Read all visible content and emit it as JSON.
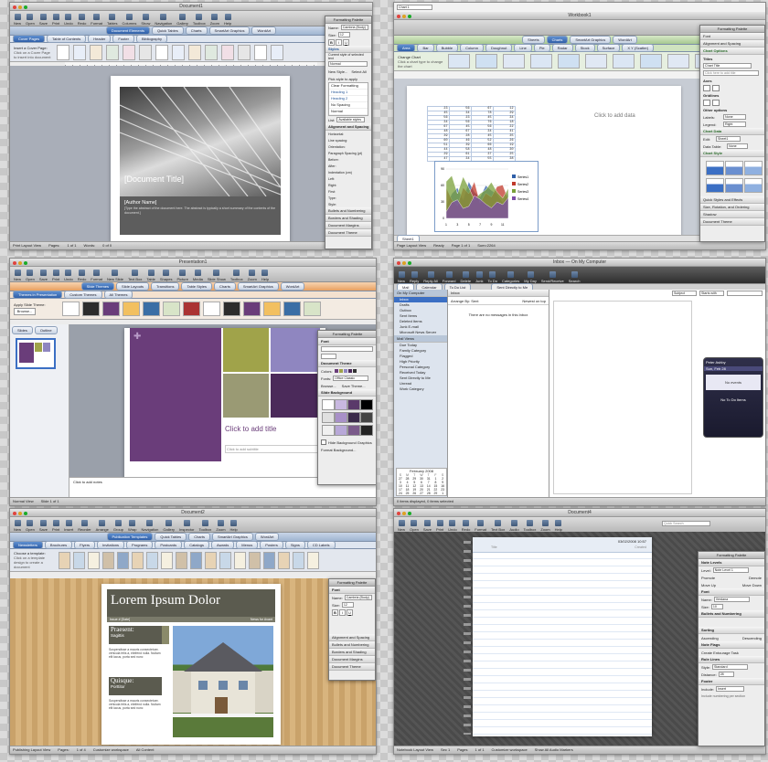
{
  "colors": {
    "accent": "#3b6fc4",
    "chart_green": "#5aa64a",
    "ppt_orange": "#f0a050",
    "purple": "#6a3d7a",
    "olive": "#a0a34a"
  },
  "word": {
    "title": "Document1",
    "toolbar": [
      "New",
      "Open",
      "Save",
      "Print",
      "Undo",
      "Redo",
      "Format",
      "Tables",
      "Columns",
      "Show",
      "Navigation",
      "Gallery",
      "Toolbox",
      "Zoom",
      "Help"
    ],
    "zoom": "100%",
    "tabs": [
      "Document Elements",
      "Quick Tables",
      "Charts",
      "SmartArt Graphics",
      "WordArt"
    ],
    "subtabs": [
      "Cover Pages",
      "Table of Contents",
      "Header",
      "Footer",
      "Bibliography"
    ],
    "insert_label": "Insert a Cover Page:",
    "hint": "Click on a Cover Page to insert into document",
    "doc_title": "[Document Title]",
    "author": "[Author Name]",
    "abstract": "[Type the abstract of the document here. The abstract is typically a short summary of the contents of the document.]",
    "status": [
      "Print Layout View",
      "Pages:",
      "1 of 1",
      "Words:",
      "0 of 0"
    ],
    "palette": {
      "title": "Formatting Palette",
      "font_label": "Name:",
      "font": "Cambria (Body)",
      "size_label": "Size:",
      "size": "12",
      "styles_title": "Styles",
      "current_style_label": "Current style of selected text",
      "current_style": "Normal",
      "new_style": "New Style...",
      "select_all": "Select All",
      "pick_label": "Pick style to apply",
      "styles": [
        "Clear Formatting",
        "Heading 1",
        "Heading 2",
        "No Spacing",
        "Normal"
      ],
      "list_label": "List:",
      "list_value": "Available styles",
      "sections": [
        "Alignment and Spacing",
        "Bullets and Numbering",
        "Borders and Shading",
        "Document Margins",
        "Document Theme"
      ],
      "fields": [
        "Horizontal:",
        "Line spacing:",
        "Orientation:",
        "Paragraph Spacing (pt)",
        "Before:",
        "After:",
        "Indentation (cm)",
        "Left:",
        "Right:",
        "First:",
        "Type:",
        "Style:"
      ],
      "values": [
        "0",
        "0",
        "0",
        "0",
        "0"
      ]
    }
  },
  "excel": {
    "title": "Workbook1",
    "namebox": "Chart 1",
    "ribbon_tabs": [
      "Sheets",
      "Charts",
      "SmartArt Graphics",
      "WordArt"
    ],
    "chart_types": [
      "Area",
      "Bar",
      "Bubble",
      "Column",
      "Doughnut",
      "Line",
      "Pie",
      "Radar",
      "Stock",
      "Surface",
      "X Y (Scatter)"
    ],
    "change_chart": "Change Chart",
    "hint": "Click a chart type to change the chart",
    "click_to_add": "Click to add data",
    "sheet_tabs": [
      "Sheet1"
    ],
    "status": [
      "Page Layout View",
      "Ready",
      "Page 1 of 1",
      "Sum=2264"
    ],
    "legend": [
      "Series1",
      "Series2",
      "Series3",
      "Series4"
    ],
    "palette": {
      "title": "Formatting Palette",
      "sections": [
        "Font",
        "Alignment and Spacing",
        "Chart Options",
        "Chart Data",
        "Chart Style",
        "Quick Styles and Effects",
        "Size, Rotation, and Ordering",
        "Shadow",
        "Document Theme"
      ],
      "titles_label": "Titles",
      "titles_value": "Chart Title",
      "titles_placeholder": "Click here to add title",
      "axes_label": "Axes",
      "gridlines_label": "Gridlines",
      "other_label": "Other options",
      "labels_label": "Labels:",
      "labels_value": "None",
      "legend_label": "Legend:",
      "legend_value": "Right",
      "data_table_label": "Data Table:",
      "data_table_value": "None",
      "edit_label": "Edit:",
      "edit_value": "Sheet1"
    }
  },
  "chart_data": {
    "type": "area",
    "title": "",
    "xlabel": "",
    "ylabel": "",
    "categories": [
      "1",
      "2",
      "3",
      "4",
      "5",
      "6",
      "7",
      "8",
      "9",
      "10",
      "11",
      "12"
    ],
    "series": [
      {
        "name": "Series1",
        "values": [
          23,
          45,
          56,
          34,
          67,
          48,
          39,
          60,
          51,
          44,
          29,
          47
        ]
      },
      {
        "name": "Series2",
        "values": [
          56,
          34,
          23,
          56,
          45,
          67,
          28,
          46,
          39,
          58,
          61,
          34
        ]
      },
      {
        "name": "Series3",
        "values": [
          67,
          78,
          45,
          76,
          56,
          34,
          45,
          52,
          66,
          48,
          37,
          55
        ]
      },
      {
        "name": "Series4",
        "values": [
          12,
          29,
          34,
          18,
          22,
          41,
          35,
          26,
          19,
          30,
          25,
          38
        ]
      }
    ],
    "ylim": [
      0,
      90
    ]
  },
  "powerpoint": {
    "title": "Presentation1",
    "toolbar": [
      "New",
      "Open",
      "Save",
      "Print",
      "Undo",
      "Redo",
      "Format",
      "New Slide",
      "Text Box",
      "Table",
      "Shapes",
      "Picture",
      "Media",
      "Slide Show",
      "Toolbox",
      "Zoom",
      "Help"
    ],
    "zoom": "66%",
    "tabs": [
      "Slide Themes",
      "Slide Layouts",
      "Transitions",
      "Table Styles",
      "Charts",
      "SmartArt Graphics",
      "WordArt"
    ],
    "subtabs": [
      "Themes in Presentation",
      "Custom Themes",
      "All Themes"
    ],
    "apply_label": "Apply Slide Theme:",
    "browse": "Browse...",
    "view_tabs": [
      "Slides",
      "Outline"
    ],
    "slide_title": "Click to add title",
    "slide_subtitle": "Click to add subtitle",
    "notes": "Click to add notes",
    "status": [
      "Normal View",
      "Slide 1 of 1"
    ],
    "palette": {
      "title": "Formatting Palette",
      "sections": [
        "Font",
        "Document Theme",
        "Slide Background"
      ],
      "colors_label": "Colors:",
      "fonts_label": "Fonts:",
      "fonts_value": "Office Classic",
      "browse": "Browse...",
      "save_theme": "Save Theme...",
      "hide_bg": "Hide Background Graphics",
      "format_bg": "Format Background..."
    }
  },
  "outlook": {
    "title": "Inbox — On My Computer",
    "toolbar": [
      "New",
      "Reply",
      "Reply All",
      "Forward",
      "Delete",
      "Junk",
      "To Do",
      "Categories",
      "My Day",
      "Send/Receive",
      "Search"
    ],
    "nav_tabs": [
      "Mail",
      "Calendar",
      "To Do List"
    ],
    "folders_header": "On My Computer",
    "folders": [
      "Inbox",
      "Drafts",
      "Outbox",
      "Sent Items",
      "Deleted Items",
      "Junk E-mail",
      "Microsoft News Server"
    ],
    "smart_header": "Mail Views",
    "smart": [
      "Due Today",
      "Family Category",
      "Flagged",
      "High Priority",
      "Personal Category",
      "Received Today",
      "Sent Directly to Me",
      "Unread",
      "Work Category"
    ],
    "list_title": "Inbox",
    "arrange_label": "Arrange By: Sent",
    "sort_label": "Newest on top",
    "empty_msg": "There are no messages in this Inbox",
    "subject_label": "Subject",
    "starts_with": "Starts with",
    "filter_label": "Sent Directly to Me",
    "calendar_month": "February 2008",
    "days": [
      "S",
      "M",
      "T",
      "W",
      "T",
      "F",
      "S"
    ],
    "dates": [
      "27",
      "28",
      "29",
      "30",
      "31",
      "1",
      "2",
      "3",
      "4",
      "5",
      "6",
      "7",
      "8",
      "9",
      "10",
      "11",
      "12",
      "13",
      "14",
      "15",
      "16",
      "17",
      "18",
      "19",
      "20",
      "21",
      "22",
      "23",
      "24",
      "25",
      "26",
      "27",
      "28",
      "29",
      "1"
    ],
    "status": "0 items displayed, 0 items selected",
    "myday": {
      "title": "Peter Ashby",
      "date_label": "Sun, Feb 28",
      "events": "No events",
      "todo": "No To Do Items"
    }
  },
  "publish": {
    "title": "Document2",
    "toolbar": [
      "New",
      "Open",
      "Save",
      "Print",
      "Insert",
      "Reorder",
      "Arrange",
      "Group",
      "Wrap",
      "Navigation",
      "Gallery",
      "Inspector",
      "Toolbox",
      "Zoom",
      "Help"
    ],
    "tabs": [
      "Publication Templates",
      "Quick Tables",
      "Charts",
      "SmartArt Graphics",
      "WordArt"
    ],
    "categories": [
      "Newsletters",
      "Brochures",
      "Flyers",
      "Invitations",
      "Programs",
      "Postcards",
      "Catalogs",
      "Awards",
      "Menus",
      "Posters",
      "Signs",
      "CD Labels"
    ],
    "choose_label": "Choose a template:",
    "hint": "Click on a template design to create a document",
    "headline": "Lorem Ipsum Dolor",
    "issue": "Issue # [Date]",
    "news_label": "News for Avant",
    "heading1": "Praesent:",
    "sub1": "Sagittis",
    "heading2": "Quisque:",
    "sub2": "Porttitor",
    "body": "Suspendisse a mauris consectetuer, vehicula felis a, eleifend nulla. Nullam elit lacus, porta sed nunc",
    "status": [
      "Publishing Layout View",
      "Pages:",
      "1 of 4"
    ],
    "workspace": "Customize workspace",
    "master": "All Content",
    "palette": {
      "title": "Formatting Palette",
      "sections": [
        "Font",
        "Alignment and Spacing",
        "Bullets and Numbering",
        "Borders and Shading",
        "Document Margins",
        "Document Theme"
      ],
      "font_label": "Name:",
      "font": "Cambria (Body)",
      "size_label": "Size:",
      "size": "12"
    }
  },
  "notebook": {
    "title": "Document4",
    "toolbar": [
      "New",
      "Open",
      "Save",
      "Print",
      "Undo",
      "Redo",
      "Format",
      "Text Box",
      "Audio",
      "Toolbox",
      "Zoom",
      "Help"
    ],
    "zoom": "100%",
    "search_placeholder": "Quick Search",
    "page_date": "03/02/2008 10:57",
    "title_label": "Title",
    "created_label": "Created",
    "status": [
      "Notebook Layout View",
      "Sec 1",
      "Pages",
      "1 of 1"
    ],
    "workspace": "Customize workspace",
    "audio": "Show All Audio Markers",
    "palette": {
      "title": "Formatting Palette",
      "sections": [
        "Note Levels",
        "Font",
        "Bullets and Numbering",
        "Sorting",
        "Note Flags",
        "Rule Lines",
        "Footer"
      ],
      "level_label": "Level:",
      "level_value": "Note Level 1",
      "promote": "Promote",
      "demote": "Demote",
      "move_up": "Move Up",
      "move_down": "Move Down",
      "font_label": "Name:",
      "font": "Verdana",
      "size_label": "Size:",
      "size": "10",
      "ascending": "Ascending",
      "descending": "Descending",
      "flag": "Create Entourage Task",
      "style_label": "Style:",
      "style_value": "Standard",
      "distance_label": "Distance:",
      "distance_value": "28",
      "include_label": "Include:",
      "include_value": "Insert",
      "footer_hint": "Include numbering per section"
    }
  }
}
